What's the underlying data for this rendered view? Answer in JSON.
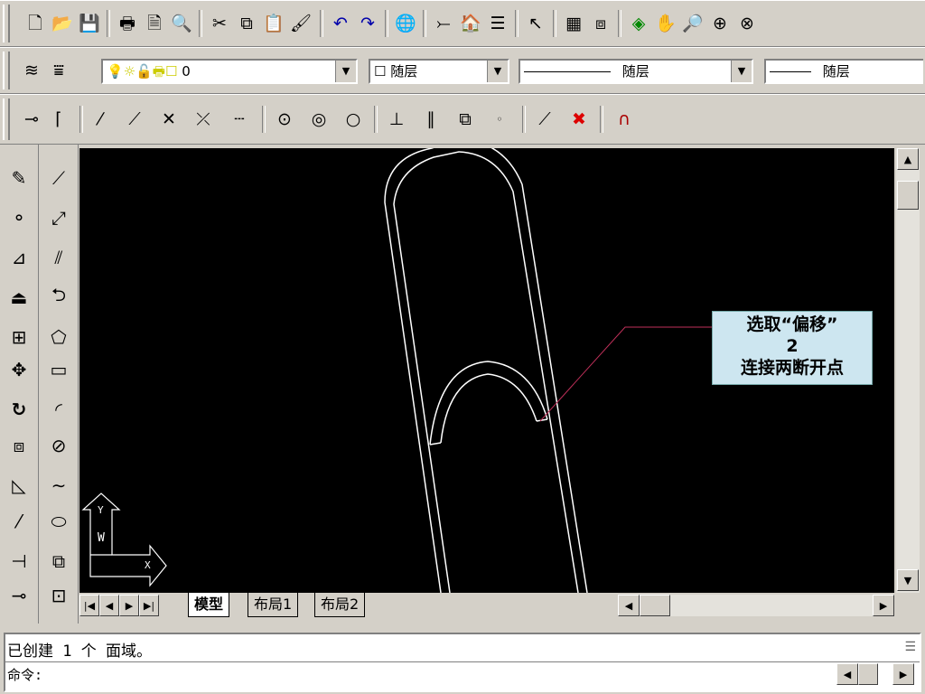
{
  "toolbar_standard": {
    "icons": [
      "new-file-icon",
      "open-folder-icon",
      "save-icon",
      "print-icon",
      "print-preview-icon",
      "spell-check-icon",
      "cut-icon",
      "copy-icon",
      "paste-icon",
      "match-properties-icon",
      "undo-icon",
      "redo-icon",
      "internet-icon",
      "ucs-icon",
      "designcenter-icon",
      "properties-icon",
      "help-pointer-icon",
      "aerial-view-icon",
      "named-views-icon",
      "3d-orbit-icon",
      "pan-icon",
      "zoom-realtime-icon",
      "zoom-window-icon",
      "zoom-previous-icon"
    ]
  },
  "layers": {
    "current_layer": "0",
    "color": "随层",
    "linetype": "随层",
    "lineweight": "随层"
  },
  "snap_toolbar": {
    "icons": [
      "temp-track-icon",
      "from-icon",
      "snap-endpoint-icon",
      "snap-midpoint-icon",
      "snap-intersection-icon",
      "snap-apparent-intersection-icon",
      "snap-extension-icon",
      "snap-center-icon",
      "snap-quadrant-icon",
      "snap-tangent-icon",
      "snap-perpendicular-icon",
      "snap-parallel-icon",
      "snap-insert-icon",
      "snap-node-icon",
      "snap-nearest-icon",
      "snap-none-icon",
      "osnap-settings-icon"
    ]
  },
  "modify_toolbar": {
    "icons": [
      "erase-icon",
      "copy-object-icon",
      "mirror-icon",
      "offset-icon",
      "array-icon",
      "move-icon",
      "rotate-icon",
      "scale-icon",
      "stretch-icon",
      "lengthen-icon",
      "trim-icon",
      "extend-icon"
    ]
  },
  "draw_toolbar": {
    "icons": [
      "line-icon",
      "construction-line-icon",
      "multiline-icon",
      "polyline-icon",
      "polygon-icon",
      "rectangle-icon",
      "arc-icon",
      "circle-icon",
      "spline-icon",
      "ellipse-icon",
      "insert-block-icon",
      "make-block-icon"
    ]
  },
  "callout": {
    "line1": "选取“偏移”",
    "line2": "2",
    "line3": "连接两断开点"
  },
  "ucs": {
    "y_label": "Y",
    "w_label": "W",
    "x_label": "X"
  },
  "tabs": {
    "model": "模型",
    "layout1": "布局1",
    "layout2": "布局2"
  },
  "command": {
    "history": "已创建 1 个 面域。",
    "prompt": "命令:"
  },
  "colors": {
    "canvas": "#000000",
    "drawing": "#ffffff",
    "leader": "#c0305a",
    "callout_bg": "#cde6f0"
  }
}
